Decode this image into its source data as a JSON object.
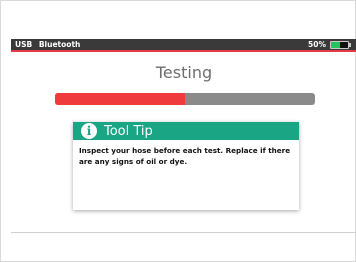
{
  "status_bar": {
    "usb_label": "USB",
    "bluetooth_label": "Bluetooth",
    "battery_percent_label": "50%",
    "battery_level": 0.5
  },
  "screen": {
    "title": "Testing",
    "progress": 0.5
  },
  "tooltip": {
    "title": "Tool Tip",
    "body": "Inspect your hose before each test.  Replace if there are any signs of oil or dye."
  },
  "colors": {
    "accent_red": "#ef3b3b",
    "header_green": "#1aa585",
    "battery_green": "#22c55e"
  }
}
